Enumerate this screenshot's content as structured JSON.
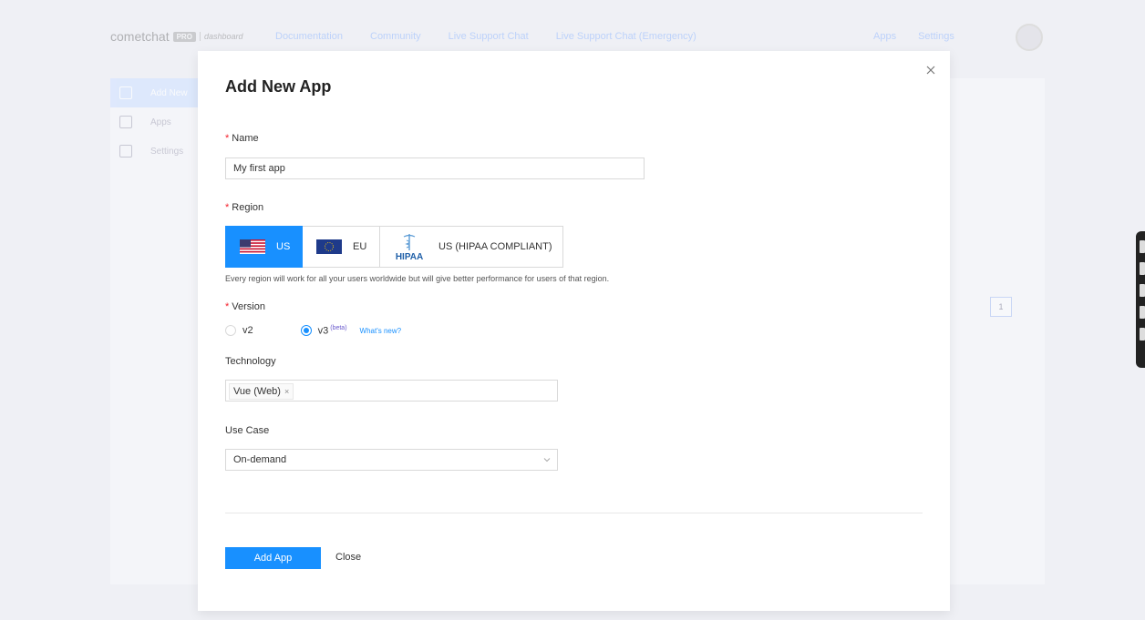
{
  "background": {
    "logo": {
      "brand": "cometchat",
      "badge": "PRO",
      "sub": "dashboard"
    },
    "nav": [
      "Documentation",
      "Community",
      "Live Support Chat",
      "Live Support Chat (Emergency)"
    ],
    "right_nav": [
      "Apps",
      "Settings"
    ],
    "sidebar": [
      "Add New",
      "Apps",
      "Settings"
    ],
    "pagination_current": "1"
  },
  "modal": {
    "title": "Add New App",
    "name": {
      "label": "Name",
      "value": "My first app"
    },
    "region": {
      "label": "Region",
      "options": [
        {
          "label": "US",
          "icon": "us-flag-icon",
          "selected": true
        },
        {
          "label": "EU",
          "icon": "eu-flag-icon",
          "selected": false
        },
        {
          "label": "US (HIPAA COMPLIANT)",
          "icon": "hipaa-logo-icon",
          "logo_text": "HIPAA",
          "selected": false
        }
      ],
      "hint": "Every region will work for all your users worldwide but will give better performance for users of that region."
    },
    "version": {
      "label": "Version",
      "options": [
        {
          "label": "v2",
          "selected": false
        },
        {
          "label": "v3",
          "badge": "(beta)",
          "selected": true
        }
      ],
      "whats_new": "What's new?"
    },
    "technology": {
      "label": "Technology",
      "tags": [
        "Vue (Web)"
      ],
      "remove_glyph": "×"
    },
    "use_case": {
      "label": "Use Case",
      "value": "On-demand"
    },
    "add_button": "Add App",
    "close_button": "Close"
  },
  "colors": {
    "primary": "#1890ff",
    "required": "#f5222d",
    "overlay": "#eff0f5"
  }
}
